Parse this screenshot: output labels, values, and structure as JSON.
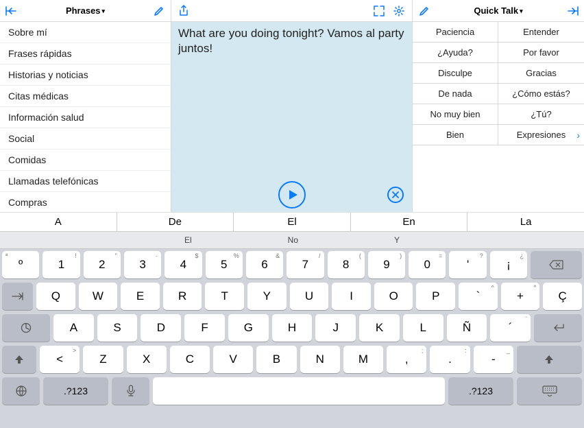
{
  "left": {
    "title": "Phrases",
    "items": [
      "Sobre mí",
      "Frases rápidas",
      "Historias y noticias",
      "Citas médicas",
      "Información salud",
      "Social",
      "Comidas",
      "Llamadas telefónicas",
      "Compras"
    ]
  },
  "center": {
    "message": "What are you doing tonight?  Vamos al party juntos!"
  },
  "right": {
    "title": "Quick Talk",
    "cells": [
      {
        "label": "Paciencia"
      },
      {
        "label": "Entender"
      },
      {
        "label": "¿Ayuda?"
      },
      {
        "label": "Por favor"
      },
      {
        "label": "Disculpe"
      },
      {
        "label": "Gracias"
      },
      {
        "label": "De nada"
      },
      {
        "label": "¿Cómo estás?"
      },
      {
        "label": "No muy bien"
      },
      {
        "label": "¿Tú?"
      },
      {
        "label": "Bien"
      },
      {
        "label": "Expresiones",
        "chevron": true
      }
    ]
  },
  "wordbar": [
    "A",
    "De",
    "El",
    "En",
    "La"
  ],
  "suggestions": [
    "El",
    "No",
    "Y"
  ],
  "keyboard": {
    "numrow": [
      {
        "tl": "ª",
        "main": "º"
      },
      {
        "tr": "!",
        "main": "1"
      },
      {
        "tr": "\"",
        "main": "2"
      },
      {
        "tr": "·",
        "main": "3"
      },
      {
        "tr": "$",
        "main": "4"
      },
      {
        "tr": "%",
        "main": "5"
      },
      {
        "tr": "&",
        "main": "6"
      },
      {
        "tr": "/",
        "main": "7"
      },
      {
        "tr": "(",
        "main": "8"
      },
      {
        "tr": ")",
        "main": "9"
      },
      {
        "tr": "=",
        "main": "0"
      },
      {
        "tr": "?",
        "main": "'"
      },
      {
        "tr": "¿",
        "main": "¡"
      }
    ],
    "row_q": [
      "Q",
      "W",
      "E",
      "R",
      "T",
      "Y",
      "U",
      "I",
      "O",
      "P"
    ],
    "row_q_extra": [
      {
        "tr": "^",
        "main": "`"
      },
      {
        "tr": "*",
        "main": "+"
      },
      {
        "main": "Ç"
      }
    ],
    "row_a": [
      "A",
      "S",
      "D",
      "F",
      "G",
      "H",
      "J",
      "K",
      "L",
      "Ñ"
    ],
    "row_a_extra": [
      {
        "tr": "¨",
        "main": "´"
      }
    ],
    "row_z_pre": [
      {
        "tr": ">",
        "main": "<"
      }
    ],
    "row_z": [
      "Z",
      "X",
      "C",
      "V",
      "B",
      "N",
      "M"
    ],
    "row_z_extra": [
      {
        "tr": ";",
        "main": ","
      },
      {
        "tr": ":",
        "main": "."
      },
      {
        "tr": "_",
        "main": "-"
      }
    ],
    "numpad_label": ".?123"
  }
}
